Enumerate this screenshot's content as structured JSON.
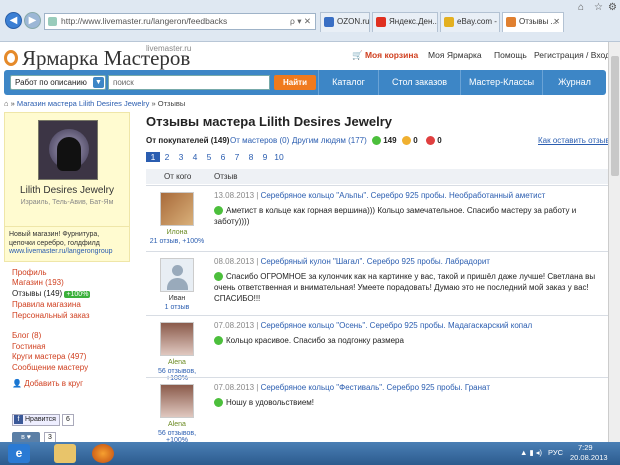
{
  "browser": {
    "address": "http://www.livemaster.ru/langeron/feedbacks",
    "address_controls": "ρ ▾ ✕",
    "tabs": [
      {
        "label": "OZON.ru",
        "color": "#3a6fc4"
      },
      {
        "label": "Яндекс.Ден...",
        "color": "#e03020"
      },
      {
        "label": "eBay.com -",
        "color": "#e4b020"
      },
      {
        "label": "Отзывы ...",
        "color": "#e08030"
      }
    ]
  },
  "site": {
    "logo": "Ярмарка Мастеров",
    "logo_sub": "livemaster.ru",
    "cart": "Моя корзина",
    "my_fair": "Моя Ярмарка",
    "help": "Помощь",
    "login": "Регистрация / Вход",
    "search_mode": "Работ по описанию",
    "search_placeholder": "поиск",
    "find": "Найти",
    "nav": [
      "Каталог",
      "Стол заказов",
      "Мастер-Классы",
      "Журнал"
    ]
  },
  "breadcrumb": {
    "shop": "Магазин мастера Lilith Desires Jewelry",
    "sep": "»",
    "current": "Отзывы"
  },
  "sidebar": {
    "shop_name": "Lilith Desires Jewelry",
    "location": "Израиль, Тель-Авив, Бат-Ям",
    "desc1": "Новый магазин! Фурнитура,",
    "desc2": "цепочки серебро, голдфилд",
    "desc_link": "www.livemaster.ru/langerongroup",
    "profile": "Профиль",
    "shop": "Магазин (193)",
    "reviews": "Отзывы (149)",
    "reviews_badge": "+100%",
    "rules": "Правила магазина",
    "personal": "Персональный заказ",
    "blog": "Блог (8)",
    "guest": "Гостиная",
    "circles": "Круги мастера (497)",
    "message": "Сообщение мастеру",
    "add_circle": "Добавить в круг",
    "like": "Нравится",
    "like_count": "6",
    "vk_count": "3"
  },
  "main": {
    "title": "Отзывы мастера Lilith Desires Jewelry",
    "filter_buyers": "От покупателей (149)",
    "filter_masters": "От мастеров (0)",
    "filter_others": "Другим людям (177)",
    "pos": "149",
    "neu": "0",
    "neg": "0",
    "how": "Как оставить отзыв?",
    "pages": [
      "1",
      "2",
      "3",
      "4",
      "5",
      "6",
      "7",
      "8",
      "9",
      "10"
    ],
    "col_from": "От кого",
    "col_review": "Отзыв",
    "rows": [
      {
        "name": "Илона",
        "count": "21 отзыв, +100%",
        "date": "13.08.2013",
        "item": "Серебряное кольцо \"Альпы\". Серебро 925 пробы. Необработанный аметист",
        "text": "Аметист в кольце как горная вершина))) Кольцо замечательное. Спасибо мастеру за работу и заботу))))"
      },
      {
        "name": "Иван",
        "count": "1 отзыв",
        "date": "08.08.2013",
        "item": "Серебряный кулон \"Шагал\". Серебро 925 пробы. Лабрадорит",
        "text": "Спасибо ОГРОМНОЕ за кулончик как на картинке у вас, такой и пришёл даже лучше! Светлана вы очень ответственная и внимательная! Умеете порадовать! Думаю это не последний мой заказ у вас! СПАСИБО!!!"
      },
      {
        "name": "Alena",
        "count": "56 отзывов, +100%",
        "date": "07.08.2013",
        "item": "Серебряное кольцо \"Осень\". Серебро 925 пробы. Мадагаскарский копал",
        "text": "Кольцо красивое. Спасибо за подгонку размера"
      },
      {
        "name": "Alena",
        "count": "56 отзывов, +100%",
        "date": "07.08.2013",
        "item": "Серебряное кольцо \"Фестиваль\". Серебро 925 пробы. Гранат",
        "text": "Ношу в удовольствием!"
      }
    ]
  },
  "taskbar": {
    "lang": "РУС",
    "time": "7:29",
    "date": "20.08.2013"
  }
}
